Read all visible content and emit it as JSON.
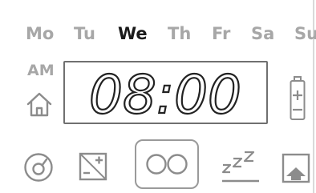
{
  "days": [
    "Mo",
    "Tu",
    "We",
    "Th",
    "Fr",
    "Sa",
    "Su"
  ],
  "active_day": "We",
  "period": "AM",
  "time": "08:00",
  "icons": {
    "home": "home-icon",
    "battery": "battery-icon",
    "auto_mode": "auto-mode-icon",
    "manual_mode": "manual-temp-icon",
    "presence": "presence-icon",
    "sleep": "sleep-icon",
    "away": "away-icon"
  },
  "colors": {
    "inactive": "#a7a7a7",
    "active": "#1a1a1a",
    "icon": "#8c8c8c"
  }
}
